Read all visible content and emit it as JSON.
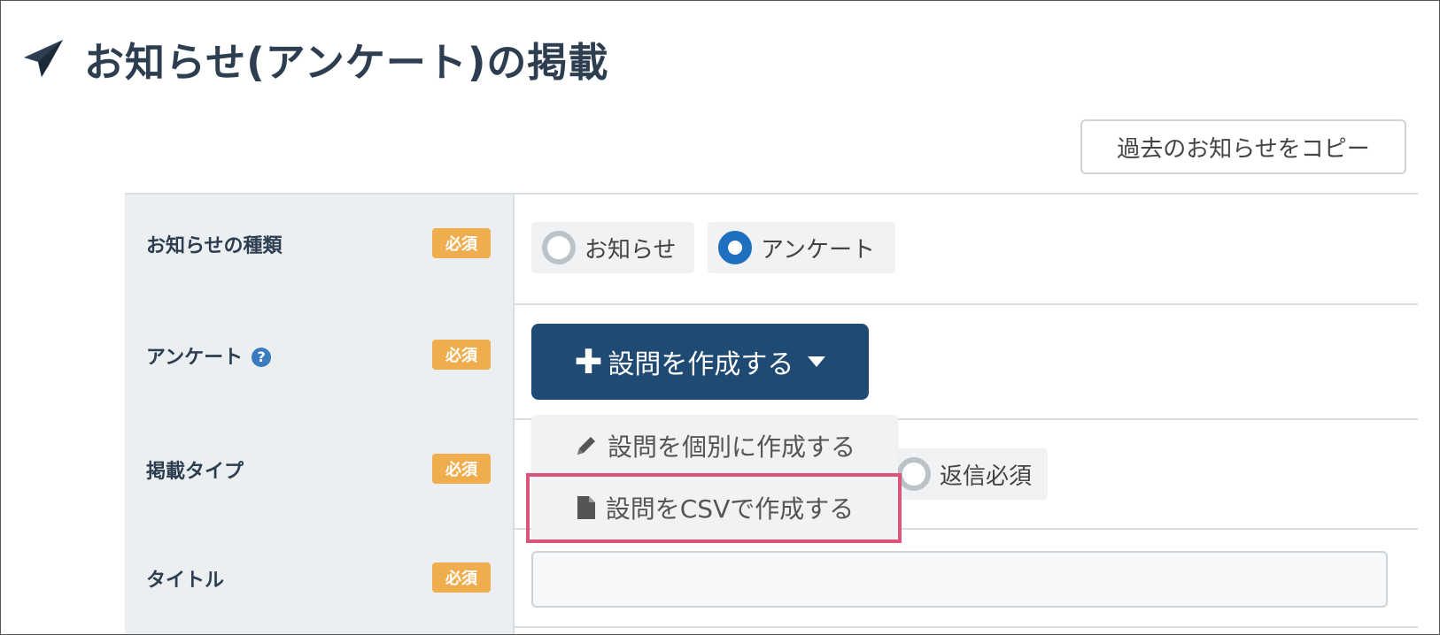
{
  "header": {
    "title": "お知らせ(アンケート)の掲載",
    "icon": "paper-plane-icon"
  },
  "copy_button": {
    "label": "過去のお知らせをコピー"
  },
  "form": {
    "required_badge": "必須",
    "rows": [
      {
        "label": "お知らせの種類"
      },
      {
        "label": "アンケート",
        "help_icon": "?"
      },
      {
        "label": "掲載タイプ"
      },
      {
        "label": "タイトル"
      }
    ],
    "notice_type": {
      "options": [
        {
          "label": "お知らせ",
          "selected": false
        },
        {
          "label": "アンケート",
          "selected": true
        }
      ]
    },
    "survey": {
      "create_button": {
        "label": "設問を作成する",
        "icon": "plus-icon"
      },
      "dropdown": [
        {
          "label": "設問を個別に作成する",
          "icon": "pencil-icon"
        },
        {
          "label": "設問をCSVで作成する",
          "icon": "file-icon",
          "highlighted": true
        }
      ]
    },
    "publish_type": {
      "option_label": "返信必須"
    },
    "title": {
      "value": "",
      "placeholder": ""
    }
  },
  "colors": {
    "primary": "#1f4a73",
    "required_badge": "#f0ad4e",
    "highlight": "#d9557a",
    "radio_selected": "#1e6fbf"
  }
}
